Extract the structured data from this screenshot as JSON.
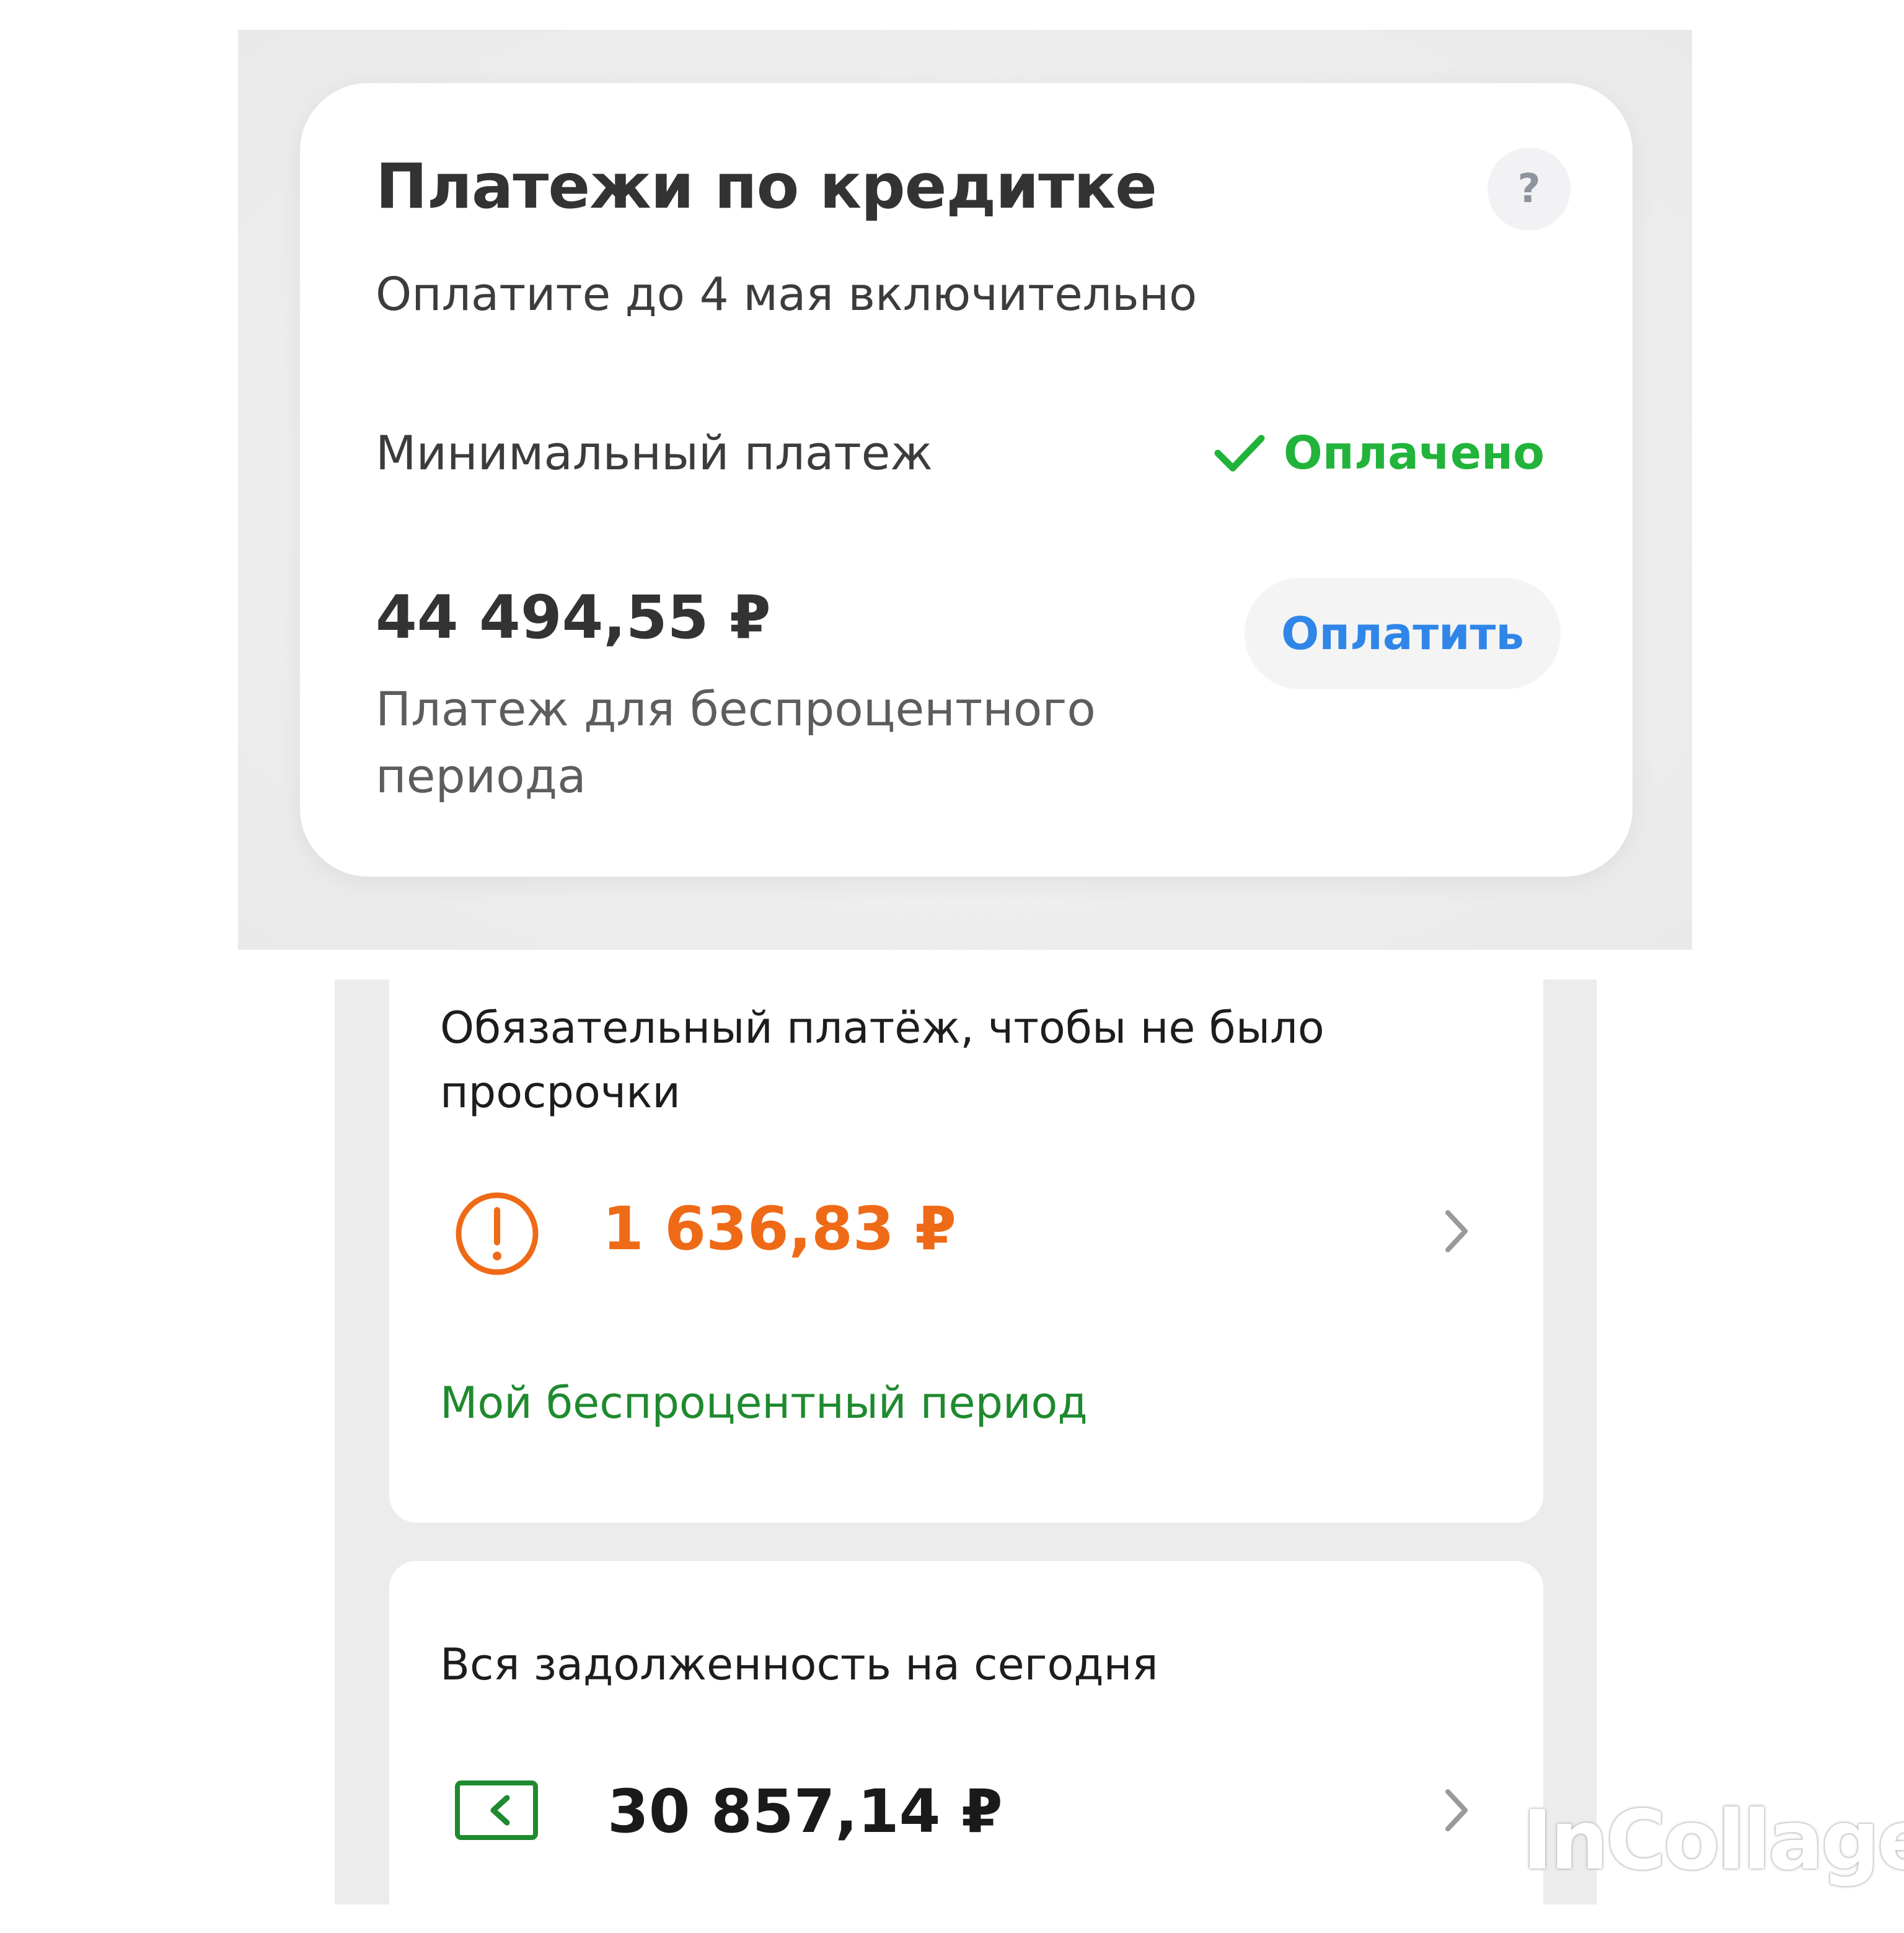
{
  "payments_card": {
    "title": "Платежи по кредитке",
    "help_label": "?",
    "due_text": "Оплатите до 4 мая включительно",
    "min_payment_label": "Минимальный платеж",
    "min_payment_status": "Оплачено",
    "amount": "44 494,55 ₽",
    "amount_description": "Платеж для беспроцентного периода",
    "pay_button_label": "Оплатить"
  },
  "mandatory_card": {
    "title": "Обязательный платёж, чтобы не было просрочки",
    "amount": "1 636,83 ₽",
    "link": "Мой беспроцентный период"
  },
  "debt_card": {
    "title": "Вся задолженность на сегодня",
    "amount": "30 857,14 ₽"
  },
  "watermark": "InCollage",
  "icons": [
    "help-icon",
    "checkmark-icon",
    "warning-icon",
    "chevron-right-icon",
    "card-arrow-icon"
  ],
  "colors": {
    "paid_green": "#21b33a",
    "link_blue": "#2f86e8",
    "warning_orange": "#ef6a17",
    "link_green": "#1f8a2f"
  }
}
